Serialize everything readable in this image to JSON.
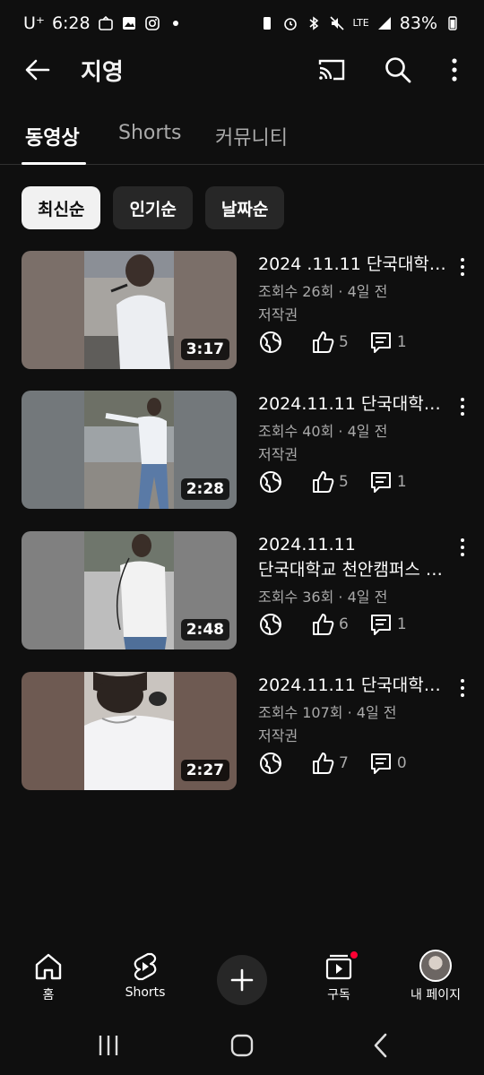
{
  "status_bar": {
    "carrier": "U⁺",
    "time": "6:28",
    "battery": "83%",
    "lte": "LTE"
  },
  "app_bar": {
    "title": "지영"
  },
  "tabs": [
    {
      "label": "동영상",
      "active": true
    },
    {
      "label": "Shorts",
      "active": false
    },
    {
      "label": "커뮤니티",
      "active": false
    }
  ],
  "chips": [
    {
      "label": "최신순",
      "active": true
    },
    {
      "label": "인기순",
      "active": false
    },
    {
      "label": "날짜순",
      "active": false
    }
  ],
  "videos": [
    {
      "title_line1": "2024 .11.11 단국대학…",
      "title_line2": "",
      "meta": "조회수 26회 · 4일 전",
      "license": "저작권",
      "duration": "3:17",
      "likes": "5",
      "comments": "1",
      "bg_color": "#7b6f69"
    },
    {
      "title_line1": "2024.11.11 단국대학…",
      "title_line2": "",
      "meta": "조회수 40회 · 4일 전",
      "license": "저작권",
      "duration": "2:28",
      "likes": "5",
      "comments": "1",
      "bg_color": "#73787b"
    },
    {
      "title_line1": "2024.11.11",
      "title_line2": "단국대학교 천안캠퍼스 …",
      "meta": "조회수 36회 · 4일 전",
      "license": "",
      "duration": "2:48",
      "likes": "6",
      "comments": "1",
      "bg_color": "#808080"
    },
    {
      "title_line1": "2024.11.11 단국대학…",
      "title_line2": "",
      "meta": "조회수 107회 · 4일 전",
      "license": "저작권",
      "duration": "2:27",
      "likes": "7",
      "comments": "0",
      "bg_color": "#6e5a52"
    }
  ],
  "bottom_nav": {
    "home": "홈",
    "shorts": "Shorts",
    "subscriptions": "구독",
    "my_page": "내 페이지"
  },
  "colors": {
    "background": "#0f0f0f",
    "chip": "#272727",
    "notification": "#ff0033"
  }
}
